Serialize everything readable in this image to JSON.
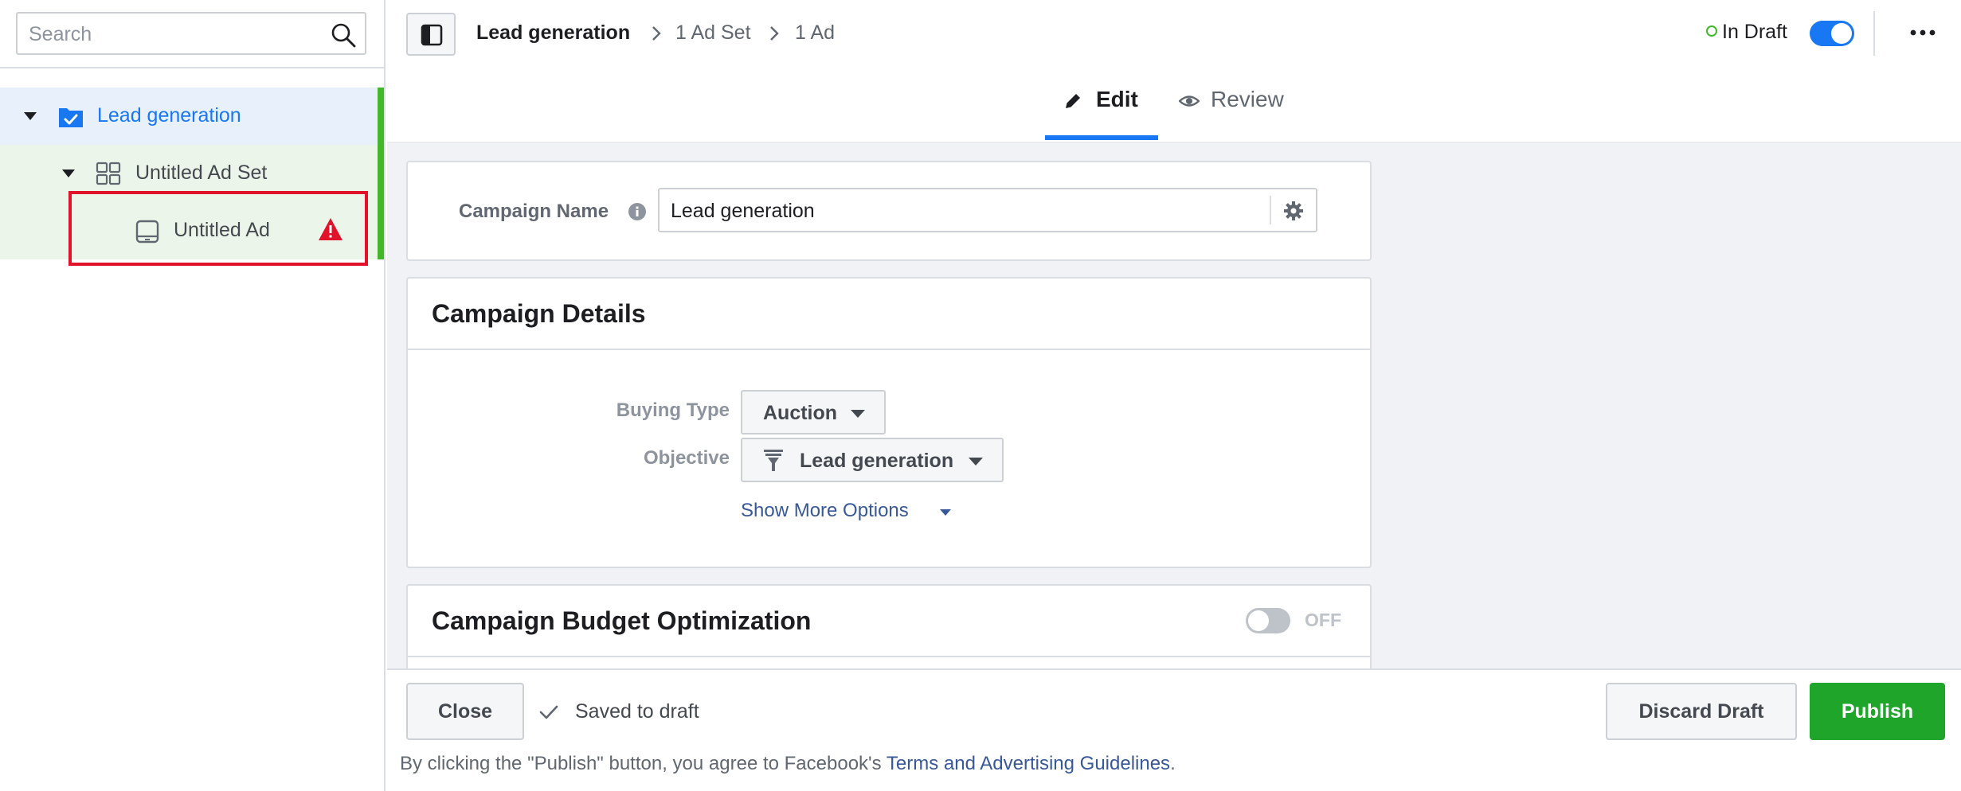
{
  "sidebar": {
    "search": {
      "placeholder": "Search",
      "value": ""
    },
    "tree": {
      "campaign": "Lead generation",
      "adset": "Untitled Ad Set",
      "ad": "Untitled Ad"
    }
  },
  "header": {
    "breadcrumbs": [
      "Lead generation",
      "1 Ad Set",
      "1 Ad"
    ],
    "status": "In Draft",
    "tabs": {
      "edit": "Edit",
      "review": "Review"
    }
  },
  "campaign_name": {
    "label": "Campaign Name",
    "value": "Lead generation"
  },
  "campaign_details": {
    "title": "Campaign Details",
    "buying_type_label": "Buying Type",
    "buying_type_value": "Auction",
    "objective_label": "Objective",
    "objective_value": "Lead generation",
    "show_more": "Show More Options"
  },
  "budget_optimization": {
    "title": "Campaign Budget Optimization",
    "toggle_state": "OFF"
  },
  "footer": {
    "close": "Close",
    "saved": "Saved to draft",
    "discard": "Discard Draft",
    "publish": "Publish",
    "legal_prefix": "By clicking the \"Publish\" button, you agree to Facebook's ",
    "legal_link": "Terms and Advertising Guidelines",
    "legal_suffix": "."
  },
  "colors": {
    "accent": "#1877f2",
    "publish": "#1fa62a",
    "warning": "#e0132a",
    "selected_bar": "#42b72a"
  }
}
